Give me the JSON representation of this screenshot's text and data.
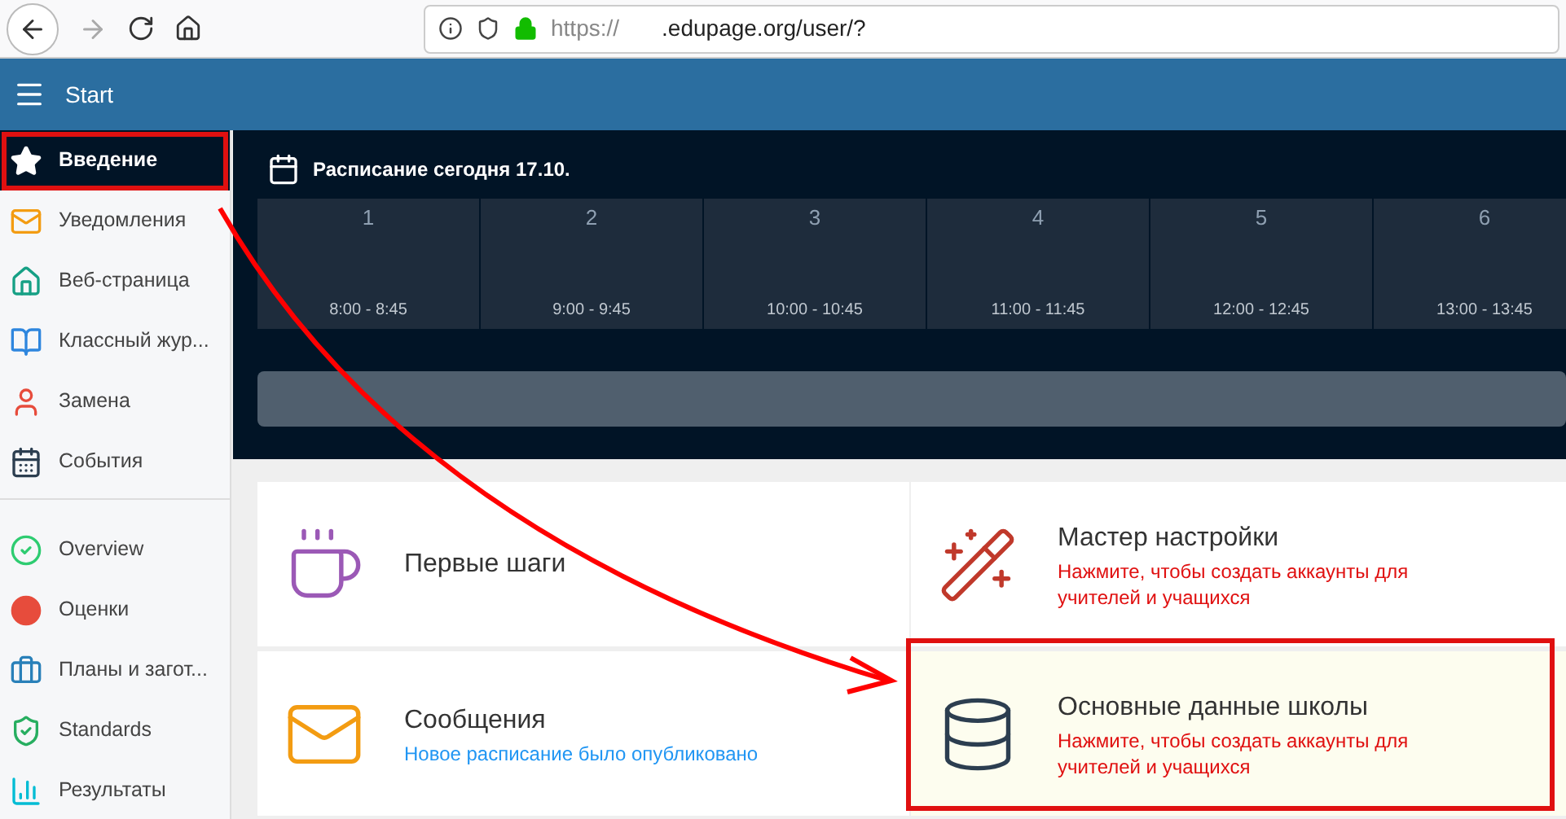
{
  "browser": {
    "url_scheme": "https://",
    "url_rest": ".edupage.org/user/?"
  },
  "header": {
    "title": "Start"
  },
  "sidebar": {
    "sections": [
      {
        "items": [
          {
            "label": "Введение",
            "selected": true
          },
          {
            "label": "Уведомления",
            "selected": false
          },
          {
            "label": "Веб-страница",
            "selected": false
          },
          {
            "label": "Классный жур...",
            "selected": false
          },
          {
            "label": "Замена",
            "selected": false
          },
          {
            "label": "События",
            "selected": false
          }
        ]
      },
      {
        "items": [
          {
            "label": "Overview",
            "selected": false
          },
          {
            "label": "Оценки",
            "selected": false
          },
          {
            "label": "Планы и загот...",
            "selected": false
          },
          {
            "label": "Standards",
            "selected": false
          },
          {
            "label": "Результаты",
            "selected": false
          }
        ]
      }
    ]
  },
  "schedule": {
    "title": "Расписание сегодня 17.10.",
    "periods": [
      {
        "number": "1",
        "time": "8:00 - 8:45"
      },
      {
        "number": "2",
        "time": "9:00 - 9:45"
      },
      {
        "number": "3",
        "time": "10:00 - 10:45"
      },
      {
        "number": "4",
        "time": "11:00 - 11:45"
      },
      {
        "number": "5",
        "time": "12:00 - 12:45"
      },
      {
        "number": "6",
        "time": "13:00 - 13:45"
      }
    ]
  },
  "cards": [
    {
      "title": "Первые шаги",
      "highlighted": false
    },
    {
      "title": "Мастер настройки",
      "subtitle": "Нажмите, чтобы создать аккаунты для учителей и учащихся",
      "kind": "alert",
      "highlighted": false
    },
    {
      "title": "Сообщения",
      "subtitle": "Новое расписание было опубликовано",
      "kind": "info",
      "highlighted": false
    },
    {
      "title": "Основные данные школы",
      "subtitle": "Нажмите, чтобы создать аккаунты для учителей и учащихся",
      "kind": "alert",
      "highlighted": true
    }
  ]
}
